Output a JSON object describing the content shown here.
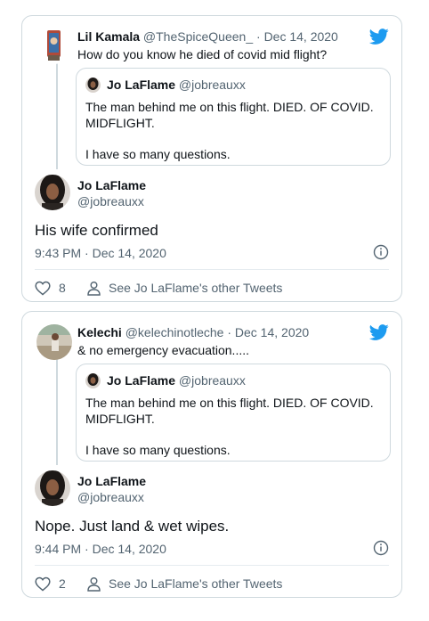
{
  "colors": {
    "accent": "#1d9bf0",
    "border": "#cfd9de",
    "secondary_text": "#536471",
    "primary_text": "#0f1419"
  },
  "icons": {
    "bird": "twitter-bird-icon",
    "info": "info-icon",
    "like": "heart-icon",
    "person": "person-icon"
  },
  "tweets": [
    {
      "reply": {
        "name": "Lil Kamala",
        "handle": "@TheSpiceQueen_",
        "dot": "·",
        "date": "Dec 14, 2020",
        "text": "How do you know he died of covid mid flight?"
      },
      "quoted": {
        "name": "Jo LaFlame",
        "handle": "@jobreauxx",
        "text_line1": "The man behind me on this flight. DIED. OF COVID. MIDFLIGHT.",
        "text_line2": "I have so many questions."
      },
      "main": {
        "name": "Jo LaFlame",
        "handle": "@jobreauxx",
        "text": "His wife confirmed",
        "timestamp": "9:43 PM · Dec 14, 2020",
        "likes": "8",
        "see_other": "See Jo LaFlame's other Tweets"
      }
    },
    {
      "reply": {
        "name": "Kelechi",
        "handle": "@kelechinotleche",
        "dot": "·",
        "date": "Dec 14, 2020",
        "text": "& no emergency evacuation....."
      },
      "quoted": {
        "name": "Jo LaFlame",
        "handle": "@jobreauxx",
        "text_line1": "The man behind me on this flight. DIED. OF COVID. MIDFLIGHT.",
        "text_line2": "I have so many questions."
      },
      "main": {
        "name": "Jo LaFlame",
        "handle": "@jobreauxx",
        "text": "Nope. Just land & wet wipes.",
        "timestamp": "9:44 PM · Dec 14, 2020",
        "likes": "2",
        "see_other": "See Jo LaFlame's other Tweets"
      }
    }
  ]
}
